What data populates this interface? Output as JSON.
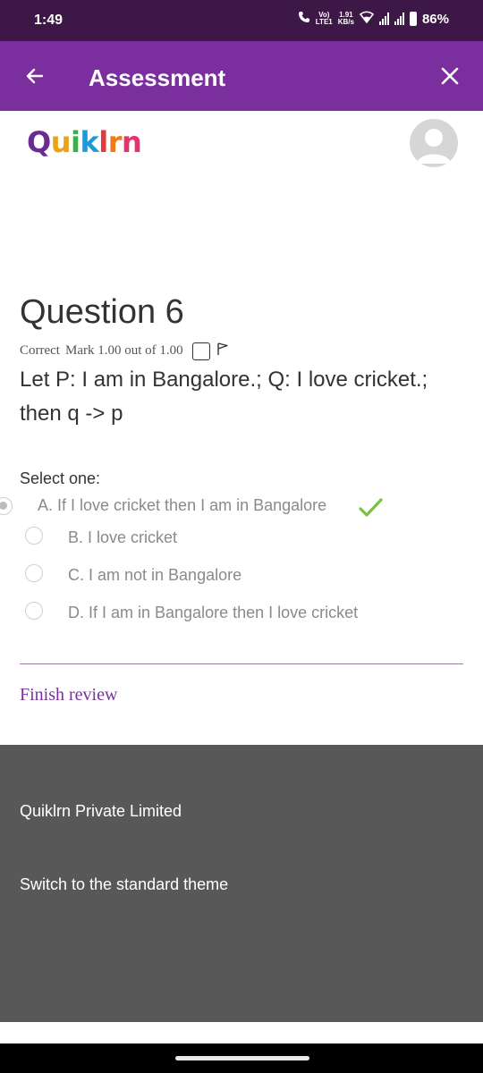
{
  "status_bar": {
    "time": "1:49",
    "network_top": "Vo)",
    "network_bottom": "LTE1",
    "speed_top": "1.91",
    "speed_bottom": "KB/s",
    "battery": "86%"
  },
  "app_bar": {
    "title": "Assessment",
    "back_icon": "arrow-left-icon",
    "close_icon": "close-icon",
    "background": "#7b2f9e"
  },
  "logo": {
    "letters": [
      "Q",
      "u",
      "i",
      "k",
      "l",
      "r",
      "n"
    ],
    "colors": [
      "#6a2c91",
      "#e9a21a",
      "#3fae49",
      "#1e9ad6",
      "#e23a3a",
      "#f07a1a",
      "#e6336b"
    ]
  },
  "question": {
    "title": "Question 6",
    "state": "Correct",
    "mark": "Mark 1.00 out of 1.00",
    "text": "Let P: I am in Bangalore.; Q: I love cricket.; then q -> p",
    "prompt": "Select one:"
  },
  "answers": [
    {
      "label": "A. If I love cricket then I am in Bangalore",
      "selected": true,
      "correct": true
    },
    {
      "label": "B. I love cricket",
      "selected": false,
      "correct": false
    },
    {
      "label": "C. I am not in Bangalore",
      "selected": false,
      "correct": false
    },
    {
      "label": "D. If I am in Bangalore then I love cricket",
      "selected": false,
      "correct": false
    }
  ],
  "finish_review": "Finish review",
  "footer": {
    "company": "Quiklrn Private Limited",
    "theme_link": "Switch to the standard theme"
  }
}
